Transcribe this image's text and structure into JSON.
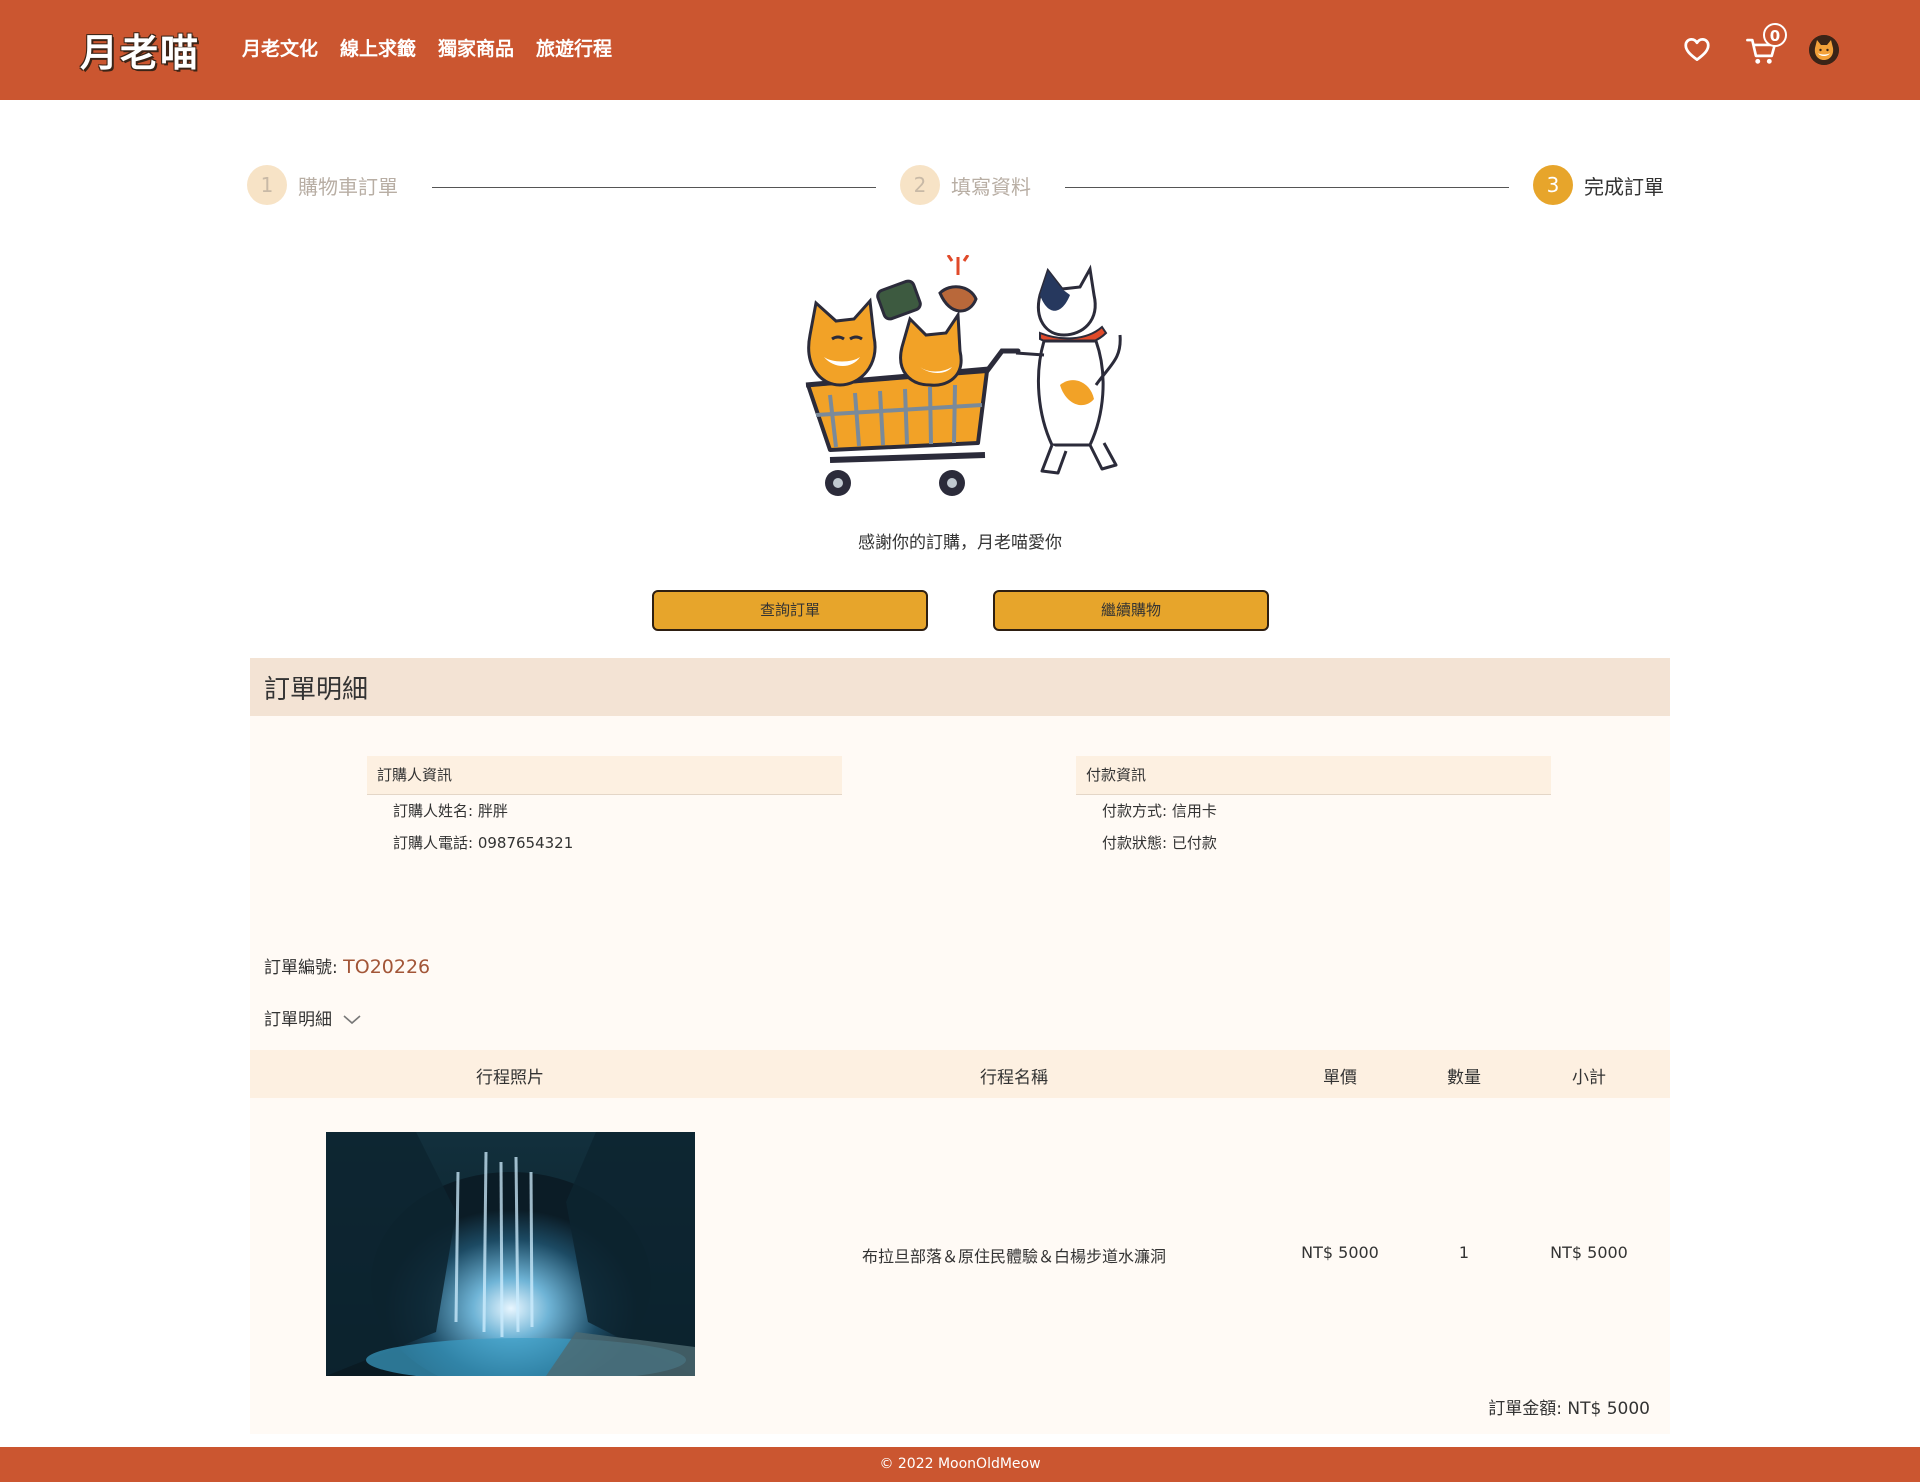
{
  "brand": {
    "logo_text": "月老喵",
    "primary_color": "#cb5630",
    "accent_color": "#e7a52b"
  },
  "nav": {
    "items": [
      "月老文化",
      "線上求籤",
      "獨家商品",
      "旅遊行程"
    ]
  },
  "header_icons": {
    "favorites": "heart-icon",
    "cart": "cart-icon",
    "cart_count": "0",
    "avatar": "cat-avatar-icon"
  },
  "steps": [
    {
      "num": "1",
      "label": "購物車訂單",
      "state": "done"
    },
    {
      "num": "2",
      "label": "填寫資料",
      "state": "done"
    },
    {
      "num": "3",
      "label": "完成訂單",
      "state": "active"
    }
  ],
  "confirmation": {
    "thanks": "感謝你的訂購，月老喵愛你",
    "query_button": "查詢訂單",
    "continue_button": "繼續購物"
  },
  "order": {
    "section_title": "訂單明細",
    "buyer": {
      "title": "訂購人資訊",
      "name_line": "訂購人姓名: 胖胖",
      "phone_line": "訂購人電話: 0987654321"
    },
    "payment": {
      "title": "付款資訊",
      "method_line": "付款方式: 信用卡",
      "status_line": "付款狀態: 已付款"
    },
    "number_label": "訂單編號: ",
    "number": "TO20226",
    "details_toggle": "訂單明細",
    "table": {
      "headers": [
        "行程照片",
        "行程名稱",
        "單價",
        "數量",
        "小計"
      ],
      "rows": [
        {
          "name": "布拉旦部落＆原住民體驗＆白楊步道水濂洞",
          "price": "NT$ 5000",
          "qty": "1",
          "subtotal": "NT$ 5000"
        }
      ]
    },
    "total": "訂單金額: NT$ 5000"
  },
  "footer": {
    "text": "© 2022 MoonOldMeow"
  }
}
